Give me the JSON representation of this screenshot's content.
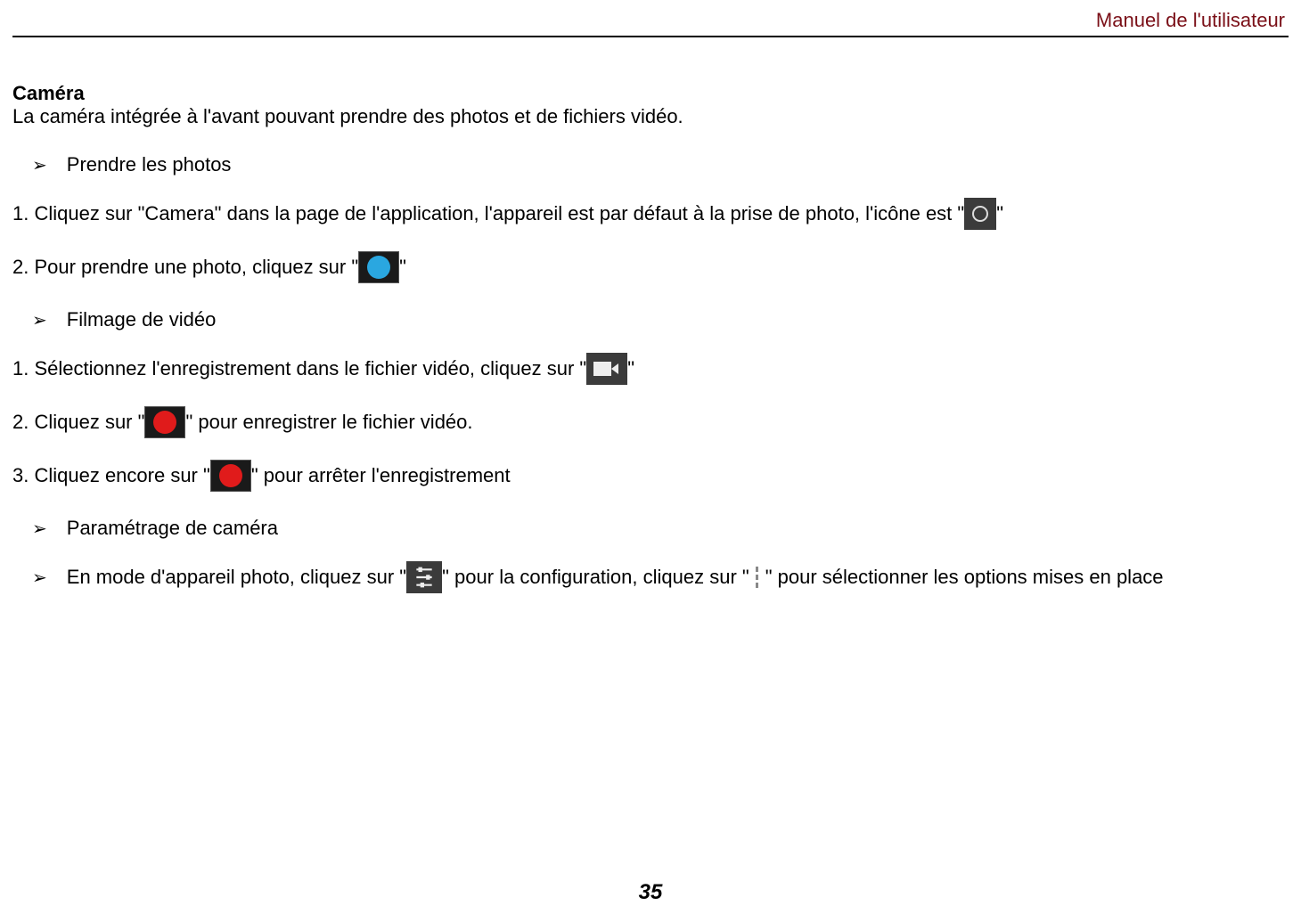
{
  "header": {
    "title": "Manuel de l'utilisateur"
  },
  "section": {
    "title": "Caméra",
    "intro": "La caméra intégrée à l'avant pouvant prendre des photos et de fichiers vidéo."
  },
  "bullets": {
    "glyph": "➢",
    "take_photos": "Prendre les photos",
    "video_filming": "Filmage de vidéo",
    "camera_settings": "Paramétrage de caméra",
    "camera_mode_pre": "En mode d'appareil photo, cliquez sur \"",
    "camera_mode_mid": "\" pour la configuration, cliquez sur \"",
    "camera_mode_post": "\" pour sélectionner les options mises en place"
  },
  "photos": {
    "step1_pre": "1. Cliquez sur \"Camera\" dans la page de l'application, l'appareil est par défaut à la prise de photo, l'icône est \"",
    "step1_post": "\"",
    "step2_pre": "2. Pour prendre une photo, cliquez sur \"",
    "step2_post": "\""
  },
  "video": {
    "step1_pre": "1. Sélectionnez l'enregistrement dans le fichier vidéo, cliquez sur \"",
    "step1_post": "\"",
    "step2_pre": "2. Cliquez sur \"",
    "step2_post": "\" pour enregistrer le fichier vidéo.",
    "step3_pre": "3. Cliquez encore sur \"",
    "step3_post": "\" pour arrêter l'enregistrement"
  },
  "page_number": "35"
}
